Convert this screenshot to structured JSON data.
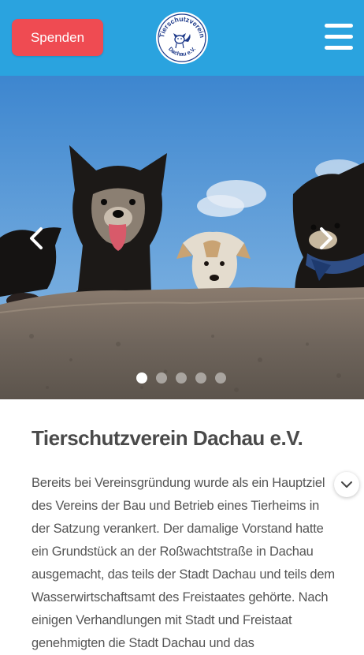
{
  "header": {
    "donate_label": "Spenden",
    "logo": {
      "top_text": "Tierschutzverein",
      "bottom_text": "Dachau e.V.",
      "icon": "dog-cat-logo-icon"
    },
    "menu_icon": "hamburger-menu-icon"
  },
  "slider": {
    "prev_icon": "chevron-left-icon",
    "next_icon": "chevron-right-icon",
    "slide_count": 5,
    "active_index": 0,
    "image": "dogs-looking-over-wall"
  },
  "article": {
    "title": "Tierschutzverein Dachau e.V.",
    "body": "Bereits bei Vereinsgründung wurde als ein Hauptziel des Vereins der Bau und Betrieb eines Tierheims in der Satzung verankert. Der damalige Vorstand hatte ein Grundstück an der Roßwachtstraße in Dachau ausgemacht, das teils der Stadt Dachau und teils dem Wasserwirtschaftsamt des Freistaates gehörte. Nach einigen Verhandlungen mit Stadt und Freistaat genehmigten die Stadt Dachau und das",
    "expand_icon": "chevron-down-icon"
  },
  "colors": {
    "header_bg": "#2aa3df",
    "donate_bg": "#ef4b52",
    "text": "#555555"
  }
}
